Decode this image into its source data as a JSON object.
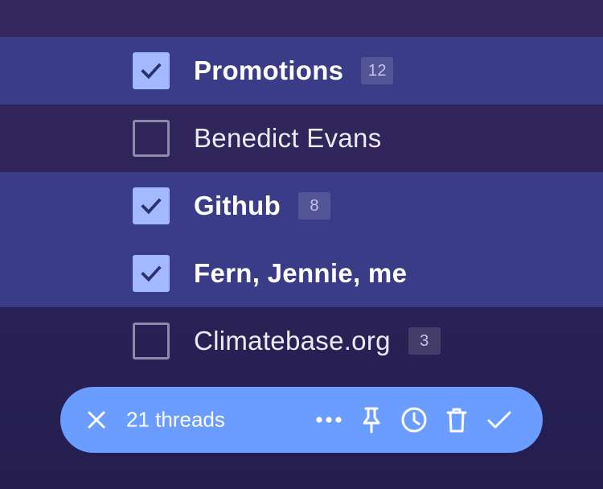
{
  "threads": [
    {
      "sender": "Promotions",
      "count": "12",
      "selected": true,
      "unread": true
    },
    {
      "sender": "Benedict Evans",
      "count": "",
      "selected": false,
      "unread": false
    },
    {
      "sender": "Github",
      "count": "8",
      "selected": true,
      "unread": true
    },
    {
      "sender": "Fern, Jennie, me",
      "count": "",
      "selected": true,
      "unread": true
    },
    {
      "sender": "Climatebase.org",
      "count": "3",
      "selected": false,
      "unread": false
    }
  ],
  "action_bar": {
    "count_label": "21 threads",
    "icons": [
      "close-icon",
      "more-icon",
      "pin-icon",
      "clock-icon",
      "trash-icon",
      "check-icon"
    ]
  },
  "colors": {
    "background": "#2d2459",
    "selected_row": "#3b3c88",
    "checkbox_checked": "#a2b8ff",
    "checkmark": "#2c2f6e",
    "action_bar": "#6b9cff"
  }
}
